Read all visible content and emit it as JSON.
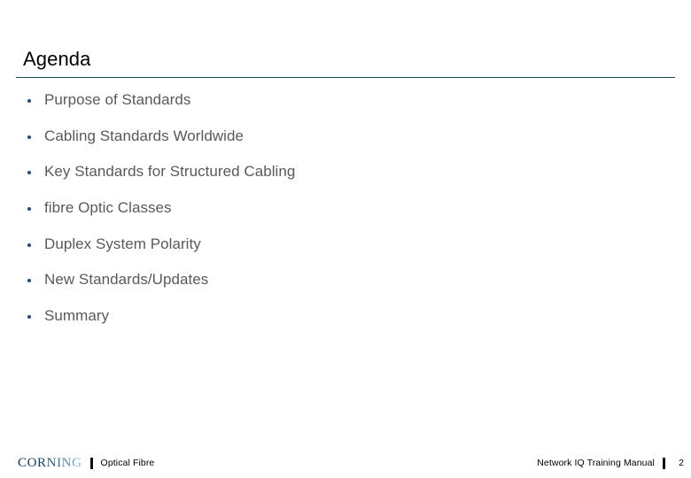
{
  "slide": {
    "title": "Agenda",
    "accent_rule_color": "#1a4a55",
    "bullet_color": "#1f4e79",
    "body_text_color": "#595959",
    "background_color": "#ffffff",
    "items": [
      {
        "label": "Purpose of Standards"
      },
      {
        "label": "Cabling Standards Worldwide"
      },
      {
        "label": "Key Standards for Structured Cabling"
      },
      {
        "label": "fibre Optic Classes"
      },
      {
        "label": "Duplex System Polarity"
      },
      {
        "label": "New Standards/Updates"
      },
      {
        "label": "Summary"
      }
    ]
  },
  "footer": {
    "brand": "CORNING",
    "separator": "|",
    "brand_subtitle": "Optical Fibre",
    "manual_title": "Network IQ Training Manual",
    "page_number": "2"
  }
}
